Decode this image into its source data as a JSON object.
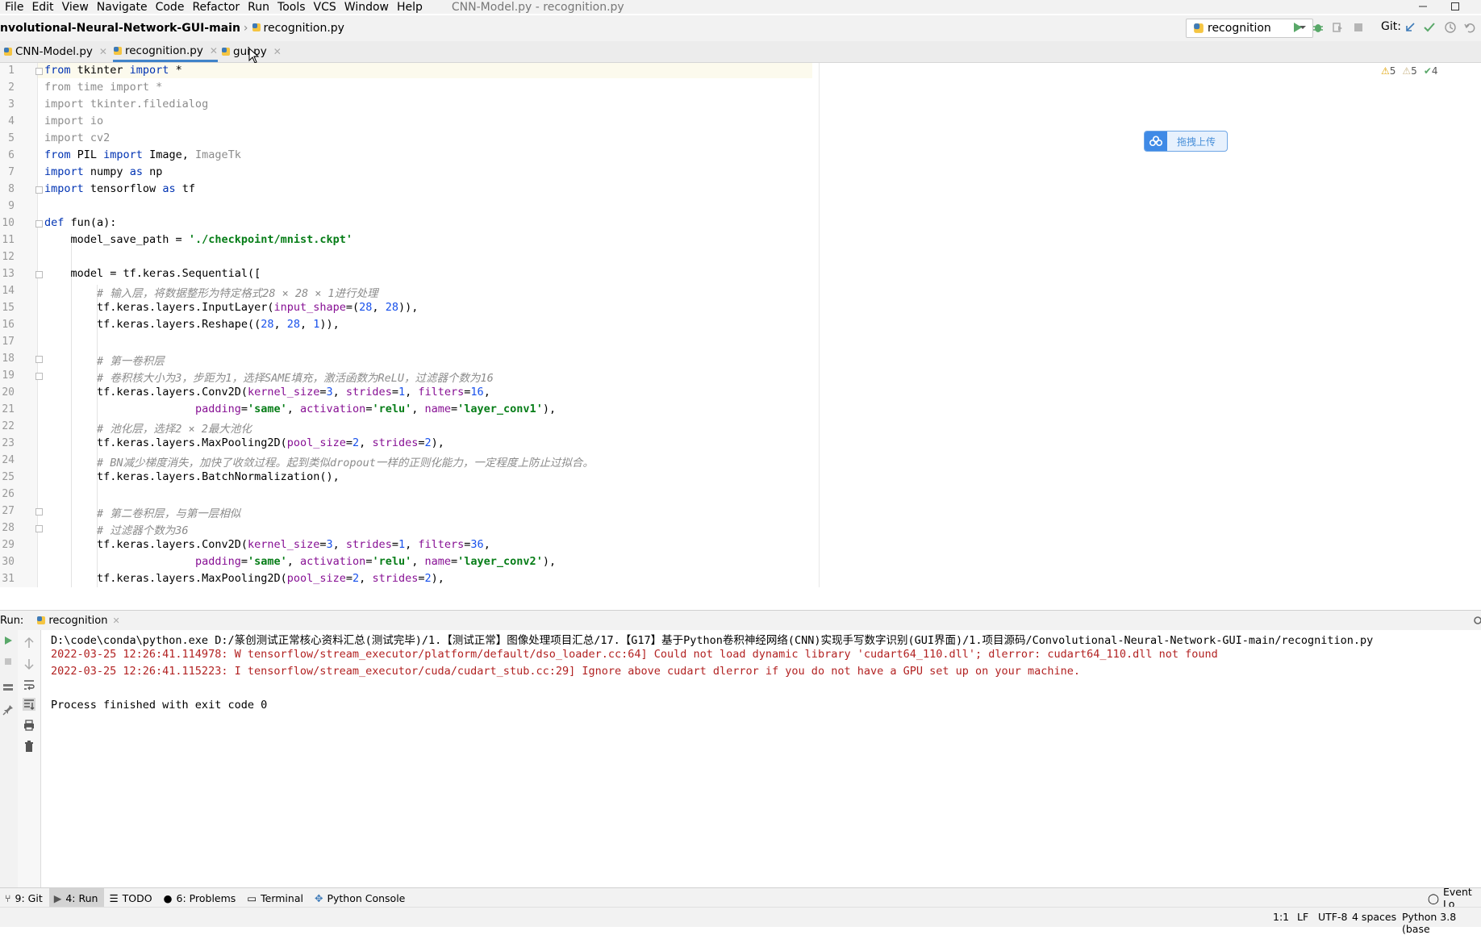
{
  "menu": [
    "File",
    "Edit",
    "View",
    "Navigate",
    "Code",
    "Refactor",
    "Run",
    "Tools",
    "VCS",
    "Window",
    "Help"
  ],
  "window_title": "CNN-Model.py - recognition.py",
  "breadcrumb": {
    "project": "nvolutional-Neural-Network-GUI-main",
    "file": "recognition.py"
  },
  "run_config": "recognition",
  "git_label": "Git:",
  "tabs": [
    {
      "label": "CNN-Model.py",
      "active": false
    },
    {
      "label": "recognition.py",
      "active": true
    },
    {
      "label": "gui.py",
      "active": false
    }
  ],
  "inspections": {
    "errors": "5",
    "warnings": "5",
    "weak": "4"
  },
  "upload_widget": "拖拽上传",
  "code": {
    "l1": {
      "a": "from",
      "b": " tkinter ",
      "c": "import",
      "d": " *"
    },
    "l2": "from time import *",
    "l3": "import tkinter.filedialog",
    "l4": "import io",
    "l5": "import cv2",
    "l6": {
      "a": "from",
      "b": " PIL ",
      "c": "import",
      "d": " Image, ",
      "e": "ImageTk"
    },
    "l7": {
      "a": "import",
      "b": " numpy ",
      "c": "as",
      "d": " np"
    },
    "l8": {
      "a": "import",
      "b": " tensorflow ",
      "c": "as",
      "d": " tf"
    },
    "l10": {
      "a": "def",
      "b": " fun(a):"
    },
    "l11": {
      "a": "    model_save_path = ",
      "b": "'./checkpoint/mnist.ckpt'"
    },
    "l13": "    model = tf.keras.Sequential([",
    "l14": "        # 输入层，将数据整形为特定格式28 × 28 × 1进行处理",
    "l15": {
      "a": "        tf.keras.layers.InputLayer(",
      "b": "input_shape",
      "c": "=(",
      "d": "28",
      "e": ", ",
      "f": "28",
      "g": ")),"
    },
    "l16": {
      "a": "        tf.keras.layers.Reshape((",
      "b": "28",
      "c": ", ",
      "d": "28",
      "e": ", ",
      "f": "1",
      "g": ")),"
    },
    "l18": "        # 第一卷积层",
    "l19": "        # 卷积核大小为3，步距为1，选择SAME填充，激活函数为ReLU，过滤器个数为16",
    "l20": {
      "a": "        tf.keras.layers.Conv2D(",
      "b": "kernel_size",
      "c": "=",
      "d": "3",
      "e": ", ",
      "f": "strides",
      "g": "=",
      "h": "1",
      "i": ", ",
      "j": "filters",
      "k": "=",
      "m": "16",
      "n": ","
    },
    "l21": {
      "a": "                       ",
      "b": "padding",
      "c": "=",
      "d": "'same'",
      "e": ", ",
      "f": "activation",
      "g": "=",
      "h": "'relu'",
      "i": ", ",
      "j": "name",
      "k": "=",
      "m": "'layer_conv1'",
      "n": "),"
    },
    "l22": "        # 池化层，选择2 × 2最大池化",
    "l23": {
      "a": "        tf.keras.layers.MaxPooling2D(",
      "b": "pool_size",
      "c": "=",
      "d": "2",
      "e": ", ",
      "f": "strides",
      "g": "=",
      "h": "2",
      "i": "),"
    },
    "l24": "        # BN减少梯度消失，加快了收敛过程。起到类似dropout一样的正则化能力，一定程度上防止过拟合。",
    "l25": "        tf.keras.layers.BatchNormalization(),",
    "l27": "        # 第二卷积层，与第一层相似",
    "l28": "        # 过滤器个数为36",
    "l29": {
      "a": "        tf.keras.layers.Conv2D(",
      "b": "kernel_size",
      "c": "=",
      "d": "3",
      "e": ", ",
      "f": "strides",
      "g": "=",
      "h": "1",
      "i": ", ",
      "j": "filters",
      "k": "=",
      "m": "36",
      "n": ","
    },
    "l30": {
      "a": "                       ",
      "b": "padding",
      "c": "=",
      "d": "'same'",
      "e": ", ",
      "f": "activation",
      "g": "=",
      "h": "'relu'",
      "i": ", ",
      "j": "name",
      "k": "=",
      "m": "'layer_conv2'",
      "n": "),"
    },
    "l31": {
      "a": "        tf.keras.layers.MaxPooling2D(",
      "b": "pool_size",
      "c": "=",
      "d": "2",
      "e": ", ",
      "f": "strides",
      "g": "=",
      "h": "2",
      "i": "),"
    }
  },
  "run": {
    "label": "Run:",
    "tab": "recognition",
    "out1": "D:\\code\\conda\\python.exe D:/篆创测试正常核心资料汇总(测试完毕)/1.【测试正常】图像处理项目汇总/17.【G17】基于Python卷积神经网络(CNN)实现手写数字识别(GUI界面)/1.项目源码/Convolutional-Neural-Network-GUI-main/recognition.py",
    "out2": "2022-03-25 12:26:41.114978: W tensorflow/stream_executor/platform/default/dso_loader.cc:64] Could not load dynamic library 'cudart64_110.dll'; dlerror: cudart64_110.dll not found",
    "out3": "2022-03-25 12:26:41.115223: I tensorflow/stream_executor/cuda/cudart_stub.cc:29] Ignore above cudart dlerror if you do not have a GPU set up on your machine.",
    "out4": "Process finished with exit code 0"
  },
  "toolwindows": {
    "git": "9: Git",
    "run": "4: Run",
    "todo": "TODO",
    "problems": "6: Problems",
    "terminal": "Terminal",
    "python_console": "Python Console",
    "event_log": "Event Lo"
  },
  "status": {
    "position": "1:1",
    "line_sep": "LF",
    "encoding": "UTF-8",
    "indent": "4 spaces",
    "interpreter": "Python 3.8 (base"
  }
}
